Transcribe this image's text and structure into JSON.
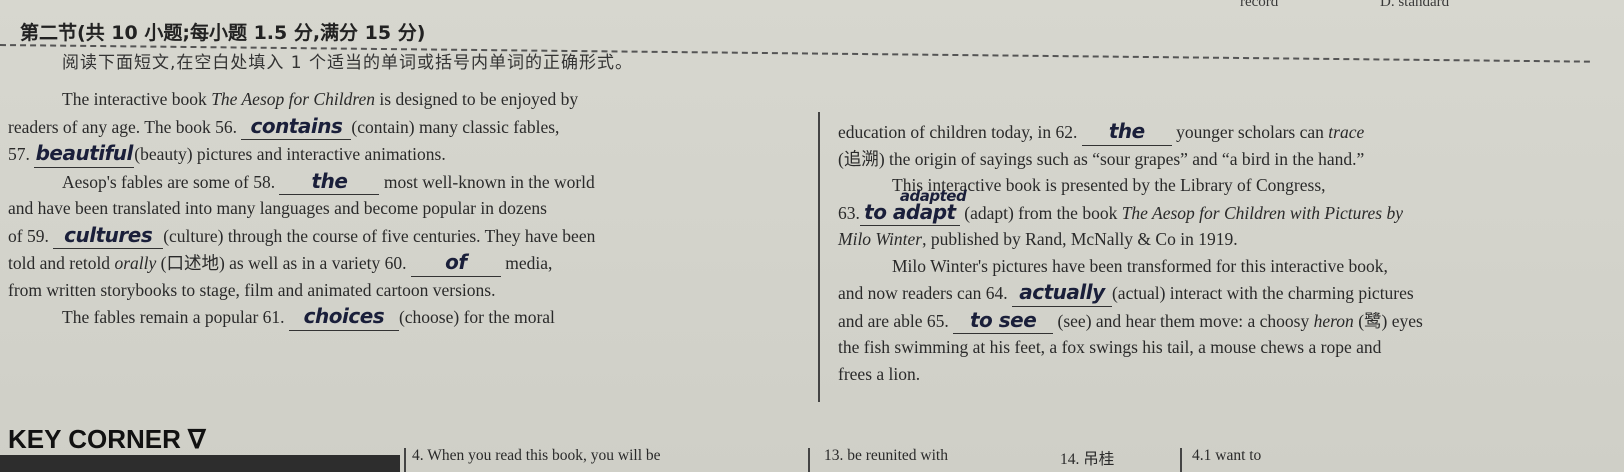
{
  "top_fragments": {
    "left": "record",
    "right": "D. standard"
  },
  "header": {
    "section_title": "第二节(共 10 小题;每小题 1.5 分,满分 15 分)",
    "instruction": "阅读下面短文,在空白处填入 1 个适当的单词或括号内单词的正确形式。"
  },
  "passage": {
    "left": {
      "p1_l1_a": "The interactive book ",
      "p1_l1_b": "The Aesop for Children",
      "p1_l1_c": " is designed to be enjoyed by",
      "p1_l2_a": "readers of any age. The book 56.",
      "a56": "contains",
      "p1_l2_b": "(contain) many classic fables,",
      "p1_l3_a": "57.",
      "a57": "beautiful",
      "p1_l3_b": "(beauty) pictures and interactive animations.",
      "p2_l1_a": "Aesop's fables are some of 58.",
      "a58": "the",
      "p2_l1_b": "most well-known in the world",
      "p2_l2": "and have been translated into many languages and become popular in dozens",
      "p2_l3_a": "of 59.",
      "a59": "cultures",
      "p2_l3_b": "(culture) through the course of five centuries. They have been",
      "p2_l4_a": "told and retold ",
      "p2_l4_b": "orally",
      "p2_l4_c": " (口述地) as well as in a variety 60.",
      "a60": "of",
      "p2_l4_d": "media,",
      "p2_l5": "from written storybooks to stage, film and animated cartoon versions.",
      "p3_l1_a": "The fables remain a popular 61.",
      "a61": "choices",
      "p3_l1_b": "(choose) for the moral"
    },
    "right": {
      "l1_a": "education of children today, in 62.",
      "a62": "the",
      "l1_b": "younger scholars can ",
      "l1_c": "trace",
      "l2": "(追溯) the origin of sayings such as “sour grapes” and “a bird in the hand.”",
      "l3": "This interactive book is presented by the Library of Congress,",
      "l4_a": "63.",
      "a63": "to adapt",
      "a63_correction": "adapted",
      "l4_b": "(adapt) from the book ",
      "l4_c": "The Aesop for Children with Pictures by",
      "l5_a": "Milo Winter",
      "l5_b": ", published by Rand, McNally & Co in 1919.",
      "l6": "Milo Winter's pictures have been transformed for this interactive book,",
      "l7_a": "and now readers can 64.",
      "a64": "actually",
      "l7_b": "(actual) interact with the charming pictures",
      "l8_a": "and are able 65.",
      "a65": "to see",
      "l8_b": "(see) and hear them move: a choosy ",
      "l8_c": "heron",
      "l8_d": " (鹭) eyes",
      "l9": "the fish swimming at his feet, a fox swings his tail, a mouse chews a rope and",
      "l10": "frees a lion."
    }
  },
  "footer": {
    "key_corner": "KEY CORNER ∇",
    "q4": "4. When you read this book, you will be",
    "q13": "13. be reunited with",
    "q14": "14. 吊桂",
    "q_last": "4.1 want to"
  }
}
